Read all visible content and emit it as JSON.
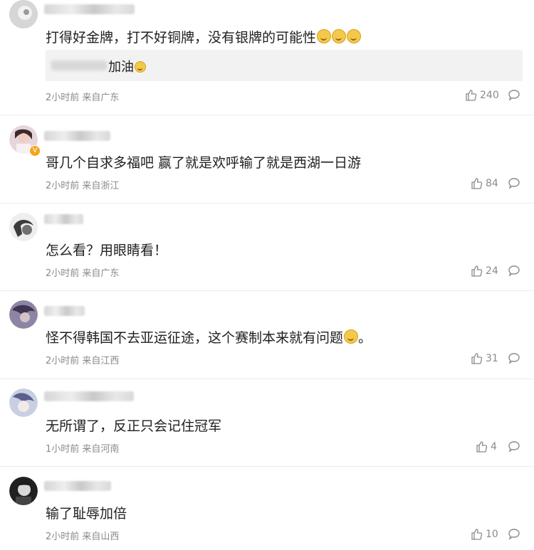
{
  "comments": [
    {
      "text": "打得好金牌，打不好铜牌，没有银牌的可能性",
      "reply": {
        "text": "加油"
      },
      "time": "2小时前 来自广东",
      "likes": "240",
      "avatar_color": "#c9c9c9"
    },
    {
      "text": "哥几个自求多福吧 赢了就是欢呼输了就是西湖一日游",
      "time": "2小时前 来自浙江",
      "likes": "84",
      "avatar_color": "#d7bfc7"
    },
    {
      "text": "怎么看？用眼睛看！",
      "time": "2小时前 来自广东",
      "likes": "24",
      "avatar_color": "#7a7a7a"
    },
    {
      "text": "怪不得韩国不去亚运征途，这个赛制本来就有问题",
      "text_suffix": "。",
      "time": "2小时前 来自江西",
      "likes": "31",
      "avatar_color": "#7f6f93"
    },
    {
      "text": "无所谓了，反正只会记住冠军",
      "time": "1小时前 来自河南",
      "likes": "4",
      "avatar_color": "#a6a6c0"
    },
    {
      "text": "输了耻辱加倍",
      "time": "2小时前 来自山西",
      "likes": "10",
      "avatar_color": "#2f2f2f"
    }
  ],
  "colors": {
    "text": "#1f1f1f",
    "meta": "#8a8a8a",
    "divider": "#ececec",
    "reply_bg": "#f2f2f2"
  },
  "icons": {
    "like": "thumbs-up-icon",
    "reply": "comment-bubble-icon",
    "emoji": "doge-emoji-icon",
    "verified": "verified-badge-icon"
  }
}
